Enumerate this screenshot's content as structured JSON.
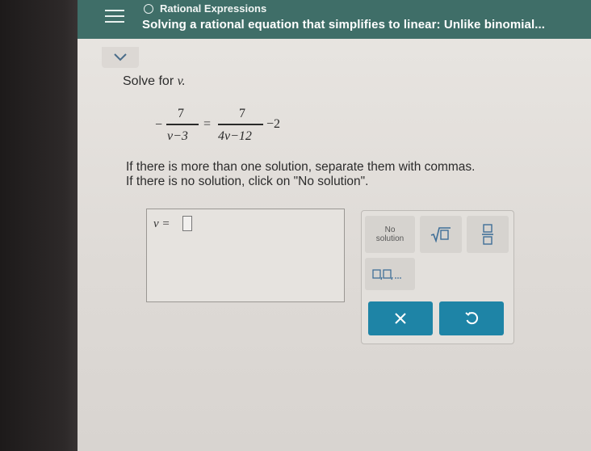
{
  "header": {
    "topic": "Rational Expressions",
    "title": "Solving a rational equation that simplifies to linear: Unlike binomial..."
  },
  "problem": {
    "prompt": "Solve for",
    "variable": "v.",
    "equation": {
      "lhs_sign": "−",
      "lhs_num": "7",
      "lhs_den": "v−3",
      "equals": "=",
      "rhs_num": "7",
      "rhs_den": "4v−12",
      "rhs_tail": "−2"
    },
    "instruction_1": "If there is more than one solution, separate them with commas.",
    "instruction_2": "If there is no solution, click on \"No solution\"."
  },
  "answer": {
    "label": "v ="
  },
  "keypad": {
    "no_solution_line1": "No",
    "no_solution_line2": "solution"
  },
  "colors": {
    "header": "#3f6e68",
    "action_button": "#1e84a6"
  }
}
